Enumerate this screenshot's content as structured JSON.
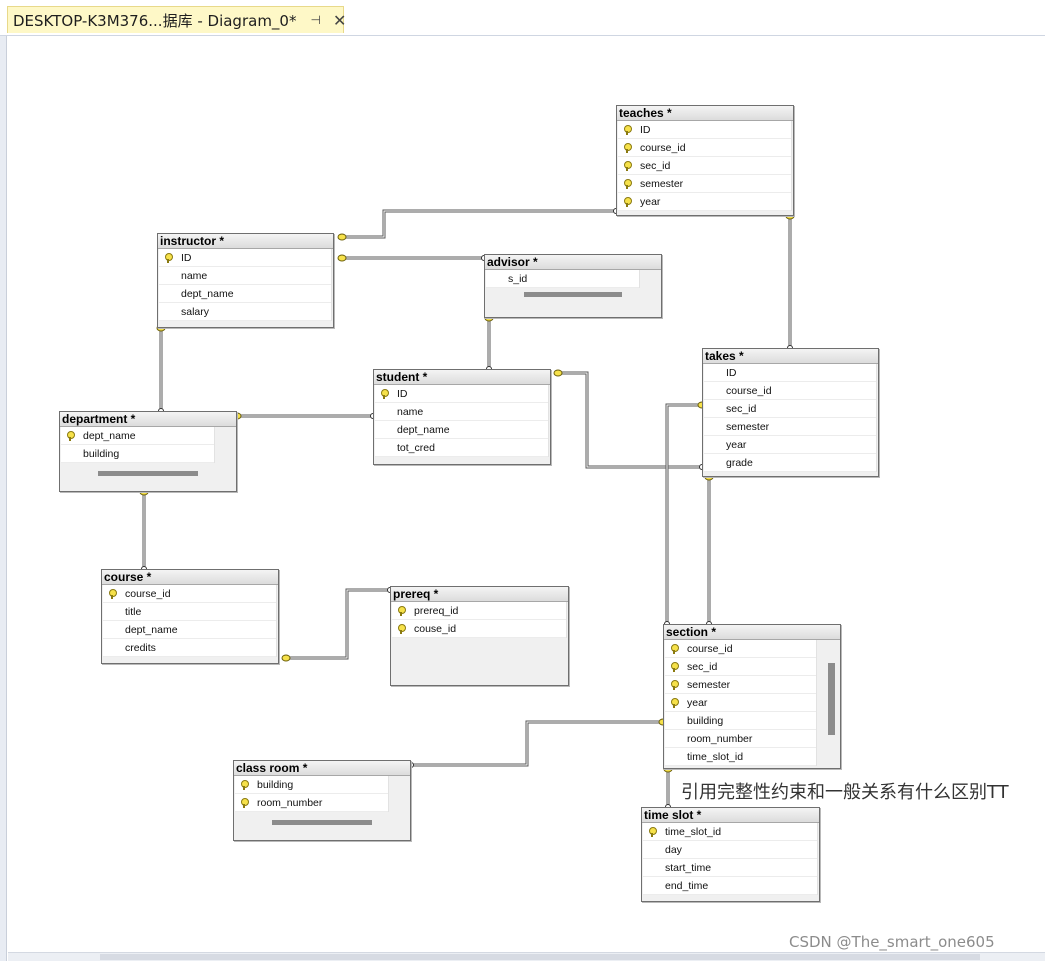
{
  "window": {
    "tab_title": "DESKTOP-K3M376...据库 - Diagram_0*",
    "pin_glyph": "⊣",
    "close_glyph": "✕"
  },
  "colors": {
    "tab_background": "#fef8c7",
    "key_icon": "#f6e14a",
    "relationship_line": "#5a5a5a"
  },
  "tables": {
    "teaches": {
      "title": "teaches *",
      "columns": [
        {
          "name": "ID",
          "key": true
        },
        {
          "name": "course_id",
          "key": true
        },
        {
          "name": "sec_id",
          "key": true
        },
        {
          "name": "semester",
          "key": true
        },
        {
          "name": "year",
          "key": true
        }
      ]
    },
    "instructor": {
      "title": "instructor *",
      "columns": [
        {
          "name": "ID",
          "key": true
        },
        {
          "name": "name",
          "key": false
        },
        {
          "name": "dept_name",
          "key": false
        },
        {
          "name": "salary",
          "key": false
        }
      ]
    },
    "advisor": {
      "title": "advisor *",
      "columns": [
        {
          "name": "s_id",
          "key": false
        }
      ]
    },
    "takes": {
      "title": "takes *",
      "columns": [
        {
          "name": "ID",
          "key": false
        },
        {
          "name": "course_id",
          "key": false
        },
        {
          "name": "sec_id",
          "key": false
        },
        {
          "name": "semester",
          "key": false
        },
        {
          "name": "year",
          "key": false
        },
        {
          "name": "grade",
          "key": false
        }
      ]
    },
    "student": {
      "title": "student *",
      "columns": [
        {
          "name": "ID",
          "key": true
        },
        {
          "name": "name",
          "key": false
        },
        {
          "name": "dept_name",
          "key": false
        },
        {
          "name": "tot_cred",
          "key": false
        }
      ]
    },
    "department": {
      "title": "department *",
      "columns": [
        {
          "name": "dept_name",
          "key": true
        },
        {
          "name": "building",
          "key": false
        }
      ]
    },
    "course": {
      "title": "course *",
      "columns": [
        {
          "name": "course_id",
          "key": true
        },
        {
          "name": "title",
          "key": false
        },
        {
          "name": "dept_name",
          "key": false
        },
        {
          "name": "credits",
          "key": false
        }
      ]
    },
    "prereq": {
      "title": "prereq *",
      "columns": [
        {
          "name": "prereq_id",
          "key": true
        },
        {
          "name": "couse_id",
          "key": true
        }
      ]
    },
    "section": {
      "title": "section *",
      "columns": [
        {
          "name": "course_id",
          "key": true
        },
        {
          "name": "sec_id",
          "key": true
        },
        {
          "name": "semester",
          "key": true
        },
        {
          "name": "year",
          "key": true
        },
        {
          "name": "building",
          "key": false
        },
        {
          "name": "room_number",
          "key": false
        },
        {
          "name": "time_slot_id",
          "key": false
        }
      ]
    },
    "classroom": {
      "title": "class room *",
      "columns": [
        {
          "name": "building",
          "key": true
        },
        {
          "name": "room_number",
          "key": true
        }
      ]
    },
    "timeslot": {
      "title": "time slot *",
      "columns": [
        {
          "name": "time_slot_id",
          "key": true
        },
        {
          "name": "day",
          "key": false
        },
        {
          "name": "start_time",
          "key": false
        },
        {
          "name": "end_time",
          "key": false
        }
      ]
    }
  },
  "caption": "引用完整性约束和一般关系有什么区别TT",
  "watermark": "CSDN @The_smart_one605"
}
